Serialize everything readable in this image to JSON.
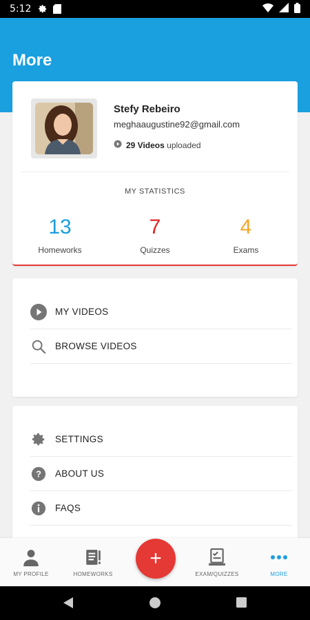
{
  "status_bar": {
    "time": "5:12",
    "icons": [
      "gear-icon",
      "sd-card-icon",
      "wifi-icon",
      "signal-icon",
      "battery-icon"
    ]
  },
  "app_bar": {
    "title": "More"
  },
  "profile": {
    "name": "Stefy Rebeiro",
    "email": "meghaaugustine92@gmail.com",
    "videos_count": "29 Videos",
    "videos_suffix": "uploaded"
  },
  "statistics": {
    "title": "MY STATISTICS",
    "items": [
      {
        "value": "13",
        "label": "Homeworks",
        "color": "#1a9fdf"
      },
      {
        "value": "7",
        "label": "Quizzes",
        "color": "#e02424"
      },
      {
        "value": "4",
        "label": "Exams",
        "color": "#f5a623"
      }
    ]
  },
  "video_menu": [
    {
      "label": "MY VIDEOS",
      "icon": "play-circle-icon"
    },
    {
      "label": "BROWSE VIDEOS",
      "icon": "search-icon"
    }
  ],
  "more_menu": [
    {
      "label": "SETTINGS",
      "icon": "gear-icon"
    },
    {
      "label": "ABOUT US",
      "icon": "help-icon"
    },
    {
      "label": "FAQS",
      "icon": "info-icon"
    }
  ],
  "bottom_nav": {
    "tabs": [
      {
        "label": "MY PROFILE",
        "icon": "person-icon"
      },
      {
        "label": "HOMEWORKS",
        "icon": "notebook-icon"
      },
      {
        "label": "EXAM/QUIZZES",
        "icon": "checklist-icon"
      },
      {
        "label": "MORE",
        "icon": "more-dots-icon",
        "active": true
      }
    ],
    "fab_label": "+"
  },
  "colors": {
    "primary": "#1a9fdf",
    "accent": "#e53935"
  }
}
